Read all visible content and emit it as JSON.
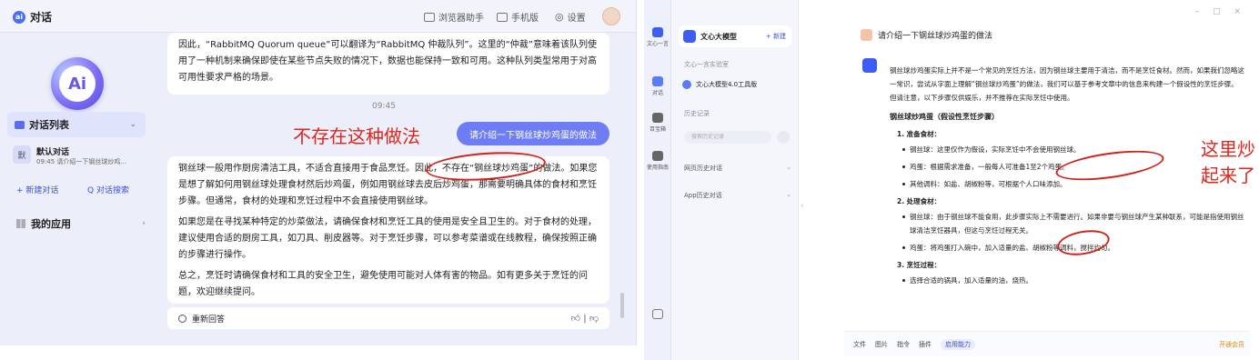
{
  "left": {
    "title": "对话",
    "top_actions": [
      "浏览器助手",
      "手机版",
      "设置"
    ],
    "sidebar": {
      "logo_text": "Ai",
      "chat_list_label": "对话列表",
      "chat_item": {
        "badge": "默",
        "title": "默认对话",
        "subtitle": "09:45 请介绍一下钢丝球炒鸡..."
      },
      "new_chat": "+ 新建对话",
      "search_chat": "Q 对话搜索",
      "my_apps": "我的应用"
    },
    "messages": {
      "card1_text": "因此，“RabbitMQ Quorum queue”可以翻译为“RabbitMQ 仲裁队列”。这里的“仲裁”意味着该队列使用了一种机制来确保即使在某些节点失败的情况下，数据也能保持一致和可用。这种队列类型常用于对高可用性要求严格的场景。",
      "time": "09:45",
      "user_question": "请介绍一下钢丝球炒鸡蛋的做法",
      "annotation": "不存在这种做法",
      "answer_p1": "钢丝球一般用作厨房清洁工具，不适合直接用于食品烹饪。因此，不存在“钢丝球炒鸡蛋”的做法。如果您是想了解如何用钢丝球处理食材然后炒鸡蛋，例如用钢丝球去皮后炒鸡蛋，那需要明确具体的食材和烹饪步骤。但通常，食材的处理和烹饪过程中不会直接使用钢丝球。",
      "answer_p2": "如果您是在寻找某种特定的炒菜做法，请确保食材和烹饪工具的使用是安全且卫生的。对于食材的处理，建议使用合适的厨房工具，如刀具、削皮器等。对于烹饪步骤，可以参考菜谱或在线教程，确保按照正确的步骤进行操作。",
      "answer_p3": "总之，烹饪时请确保食材和工具的安全卫生，避免使用可能对人体有害的物品。如有更多关于烹饪的问题，欢迎继续提问。",
      "regenerate": "重新回答"
    }
  },
  "right": {
    "rail": [
      "文心一言",
      "对话",
      "百宝箱",
      "使用指南"
    ],
    "sidebar": {
      "model_name": "文心大模型",
      "new_label": "+ 新建",
      "section1": "文心一言实验室",
      "tool_name": "文心大模型4.0工具版",
      "section2": "历史记录",
      "search_placeholder": "搜索历史记录",
      "web_history": "网页历史对话",
      "app_history": "App历史对话"
    },
    "question": "请介绍一下钢丝球炒鸡蛋的做法",
    "answer": {
      "intro": "钢丝球炒鸡蛋实际上并不是一个常见的烹饪方法，因为钢丝球主要用于清洁，而不是烹饪食材。然而，如果我们忽略这一常识，尝试从字面上理解“钢丝球炒鸡蛋”的做法，我们可以基于参考文章中的信息来构建一个假设性的烹饪步骤。但请注意，以下步骤仅供娱乐，并不推荐在实际烹饪中使用。",
      "heading": "钢丝球炒鸡蛋（假设性烹饪步骤）",
      "step1": "1. 准备食材：",
      "step1_items": [
        "钢丝球：这里仅作为假设，实际烹饪中不会使用钢丝球。",
        "鸡蛋：根据需求准备，一般每人可准备1至2个鸡蛋。",
        "其他调料：如盐、胡椒粉等，可根据个人口味添加。"
      ],
      "step2": "2. 处理食材：",
      "step2_items": [
        "钢丝球：由于钢丝球不能食用，此步骤实际上不需要进行。如果非要与钢丝球产生某种联系，可能是指使用钢丝球清洁烹饪器具，但这与烹饪过程无关。",
        "鸡蛋：将鸡蛋打入碗中，加入适量的盐、胡椒粉等调料，搅拌均匀。"
      ],
      "step3": "3. 烹饪过程：",
      "step3_items": [
        "选择合适的锅具，加入适量的油，烧热。"
      ]
    },
    "annotation": "这里炒起来了",
    "input_bar": [
      "文件",
      "图片",
      "指令",
      "插件"
    ],
    "capability": "启用能力",
    "vip": "开通会员"
  },
  "colors": {
    "accent": "#6f7df5",
    "annotation": "#e0251c",
    "brand_blue": "#3d5cf2"
  }
}
